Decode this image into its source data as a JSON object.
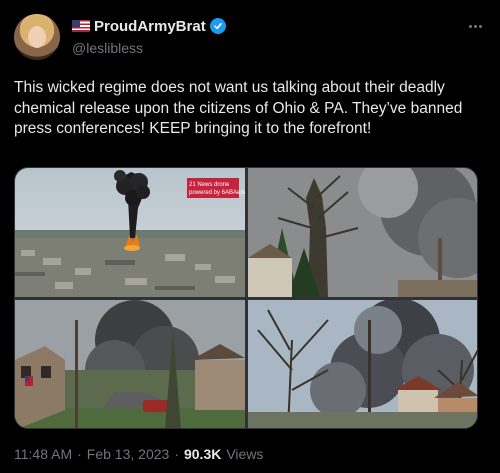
{
  "author": {
    "display_name": "ProudArmyBrat",
    "handle": "@leslibless",
    "verified": true,
    "flag_icon": "us-flag-icon"
  },
  "tweet": {
    "text": "This wicked regime does not want us talking about their deadly chemical release upon the citizens of Ohio & PA. They’ve banned press conferences! KEEP bringing it to the forefront!"
  },
  "media": {
    "photo1_caption": "21 News drone powered by 6ABAerials"
  },
  "footer": {
    "time": "11:48 AM",
    "separator": "·",
    "date": "Feb 13, 2023",
    "views_count": "90.3K",
    "views_label": "Views"
  },
  "colors": {
    "background": "#000000",
    "text": "#e7e9ea",
    "muted": "#71767b",
    "verified": "#1d9bf0"
  }
}
